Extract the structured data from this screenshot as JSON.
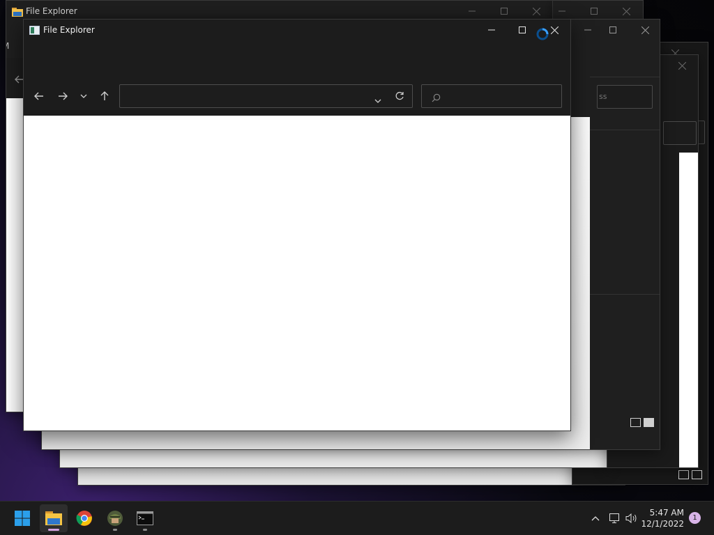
{
  "windows": {
    "front_title": "File Explorer",
    "back_title": "File Explorer",
    "back_left_letter": "M",
    "back_left_row": "[",
    "back_search_fragment": "ss"
  },
  "taskbar": {
    "time": "5:47 AM",
    "date": "12/1/2022",
    "notification_count": "1",
    "apps": [
      "start",
      "file-explorer",
      "chrome",
      "game",
      "terminal"
    ]
  },
  "colors": {
    "accent": "#0078d4",
    "window_bg": "#1c1c1c",
    "content_bg": "#ffffff"
  }
}
